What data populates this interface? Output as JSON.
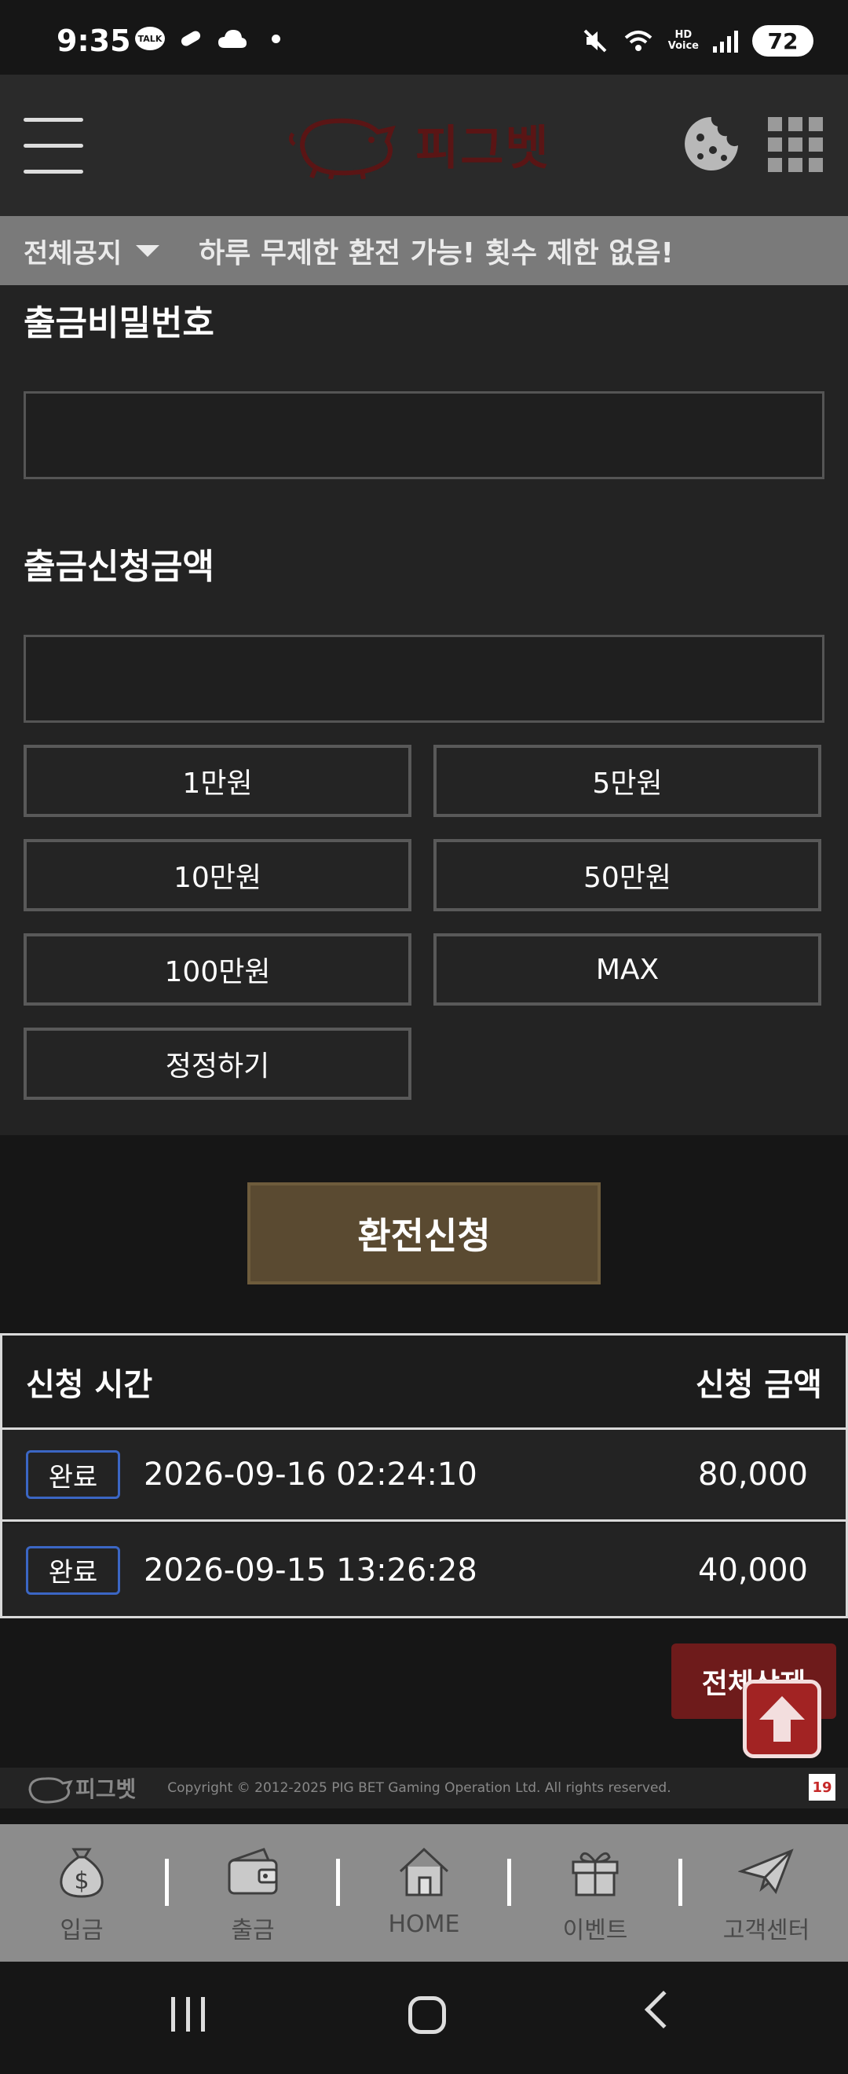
{
  "status_bar": {
    "time": "9:35",
    "talk_badge": "TALK",
    "hd_label_top": "HD",
    "hd_label_bottom": "Voice",
    "battery": "72",
    "icons": [
      "kakaotalk-icon",
      "pill-icon",
      "cloud-icon",
      "mute-icon",
      "wifi-icon",
      "signal-icon",
      "battery-icon"
    ]
  },
  "header": {
    "logo_text": "피그벳",
    "icons": [
      "menu-icon",
      "cookie-icon",
      "app-grid-icon"
    ],
    "logo_color": "#5a1515"
  },
  "notice": {
    "label": "전체공지",
    "text": "하루 무제한 환전 가능! 횟수 제한 없음!"
  },
  "form": {
    "password_label": "출금비밀번호",
    "password_value": "",
    "amount_label": "출금신청금액",
    "amount_value": "",
    "amount_buttons": [
      "1만원",
      "5만원",
      "10만원",
      "50만원",
      "100만원",
      "MAX",
      "정정하기"
    ]
  },
  "submit": {
    "label": "환전신청",
    "color": "#5a4a31"
  },
  "history": {
    "col_time": "신청 시간",
    "col_amount": "신청 금액",
    "rows": [
      {
        "status": "완료",
        "time": "2026-09-16 02:24:10",
        "amount": "80,000"
      },
      {
        "status": "완료",
        "time": "2026-09-15 13:26:28",
        "amount": "40,000"
      }
    ],
    "badge_color": "#3b66c4"
  },
  "delete_all": {
    "label": "전체삭제",
    "color": "#6e1b1b"
  },
  "footer": {
    "logo_text": "피그벳",
    "copyright": "Copyright © 2012-2025 PIG BET Gaming Operation Ltd. All rights reserved.",
    "age_badge": "19"
  },
  "bottom_nav": [
    {
      "label": "입금",
      "icon": "money-bag-icon"
    },
    {
      "label": "출금",
      "icon": "wallet-icon"
    },
    {
      "label": "HOME",
      "icon": "home-icon"
    },
    {
      "label": "이벤트",
      "icon": "gift-icon"
    },
    {
      "label": "고객센터",
      "icon": "paper-plane-icon"
    }
  ]
}
